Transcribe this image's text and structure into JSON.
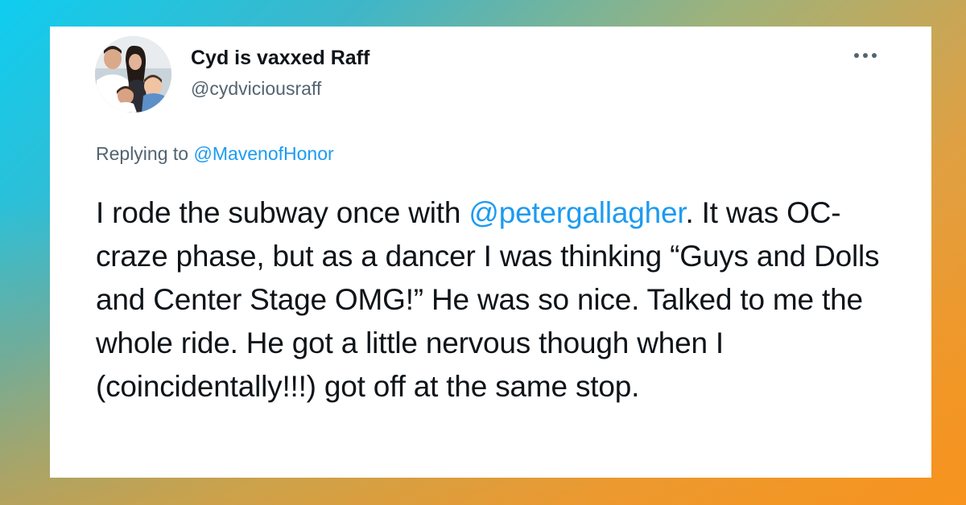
{
  "tweet": {
    "author": {
      "display_name": "Cyd is vaxxed Raff",
      "handle": "@cydviciousraff",
      "avatar_icon": "family-photo-avatar"
    },
    "more_icon": "more-options-icon",
    "replying_prefix": "Replying to ",
    "replying_to": "@MavenofHonor",
    "text_part1": "I rode the subway once with ",
    "mention": "@petergallagher",
    "text_part2": ". It was OC-craze phase, but as a dancer I was thinking “Guys and Dolls and Center Stage OMG!” He was so nice. Talked to me the whole ride. He got a little nervous though when I (coincidentally!!!) got off at the same stop."
  },
  "colors": {
    "link": "#1d9bf0",
    "text": "#0f1419",
    "secondary": "#536471",
    "frame_start": "#0fcdf0",
    "frame_end": "#f7931e"
  }
}
